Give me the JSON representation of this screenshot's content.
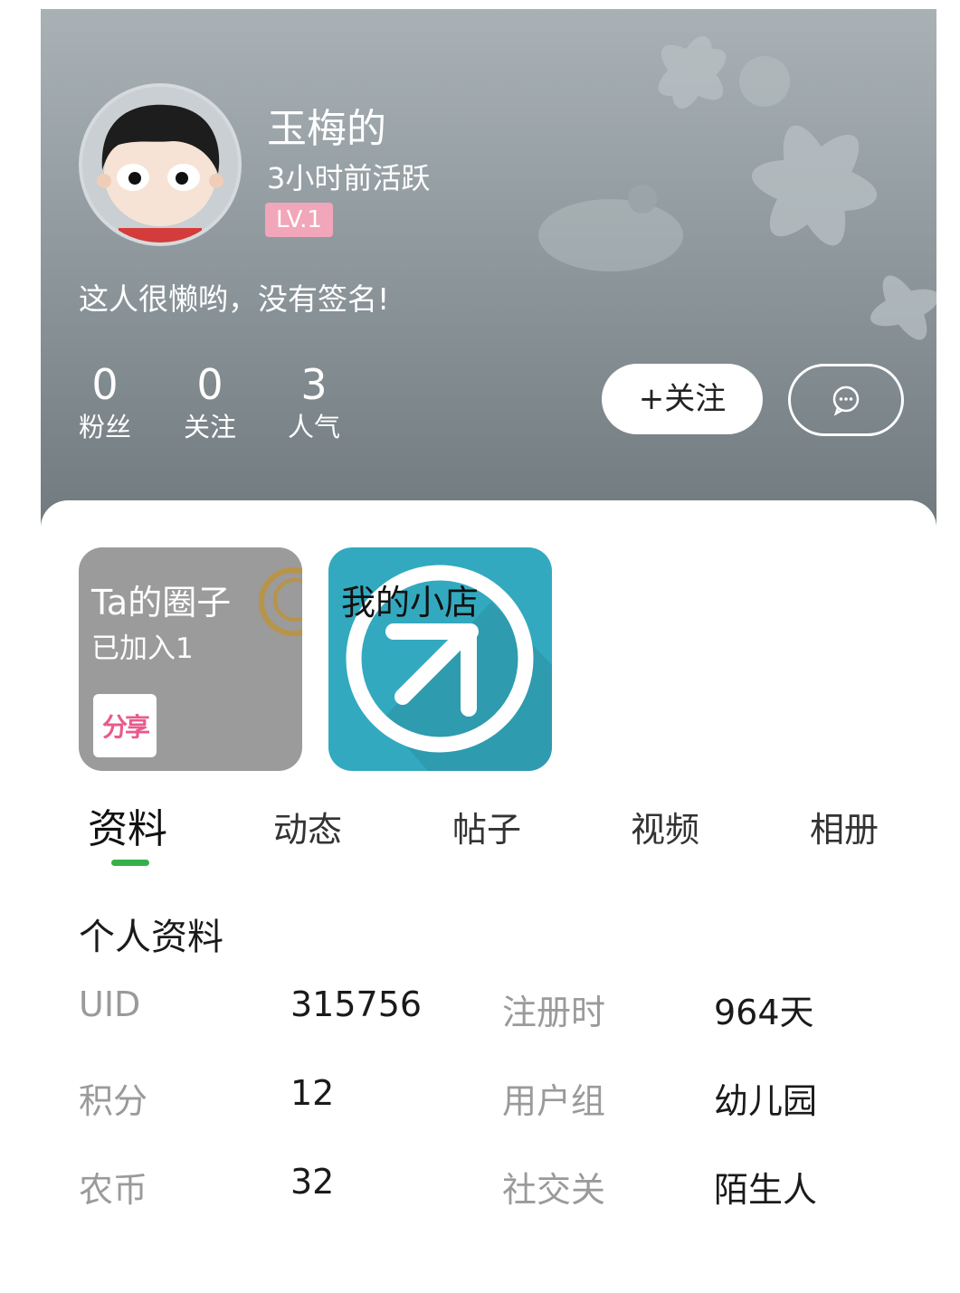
{
  "profile": {
    "username": "玉梅的",
    "active_status": "3小时前活跃",
    "level": "LV.1",
    "signature": "这人很懒哟，没有签名!",
    "stats": [
      {
        "value": "0",
        "label": "粉丝"
      },
      {
        "value": "0",
        "label": "关注"
      },
      {
        "value": "3",
        "label": "人气"
      }
    ],
    "follow_label": "+关注",
    "message_icon": "chat-bubble-icon"
  },
  "cards": {
    "circle": {
      "title": "Ta的圈子",
      "subtitle": "已加入1",
      "badge": "分享"
    },
    "shop": {
      "title": "我的小店",
      "icon": "arrow-up-right-icon"
    }
  },
  "tabs": [
    "资料",
    "动态",
    "帖子",
    "视频",
    "相册"
  ],
  "active_tab": "资料",
  "info": {
    "section_title": "个人资料",
    "rows": [
      {
        "label1": "UID",
        "value1": "315756",
        "label2": "注册时",
        "value2": "964天"
      },
      {
        "label1": "积分",
        "value1": "12",
        "label2": "用户组",
        "value2": "幼儿园"
      },
      {
        "label1": "农币",
        "value1": "32",
        "label2": "社交关",
        "value2": "陌生人"
      }
    ]
  },
  "colors": {
    "accent": "#35b14a",
    "level_badge": "#f2a6b9",
    "shop_card": "#33a9bf",
    "circle_card": "#9b9b9b"
  }
}
